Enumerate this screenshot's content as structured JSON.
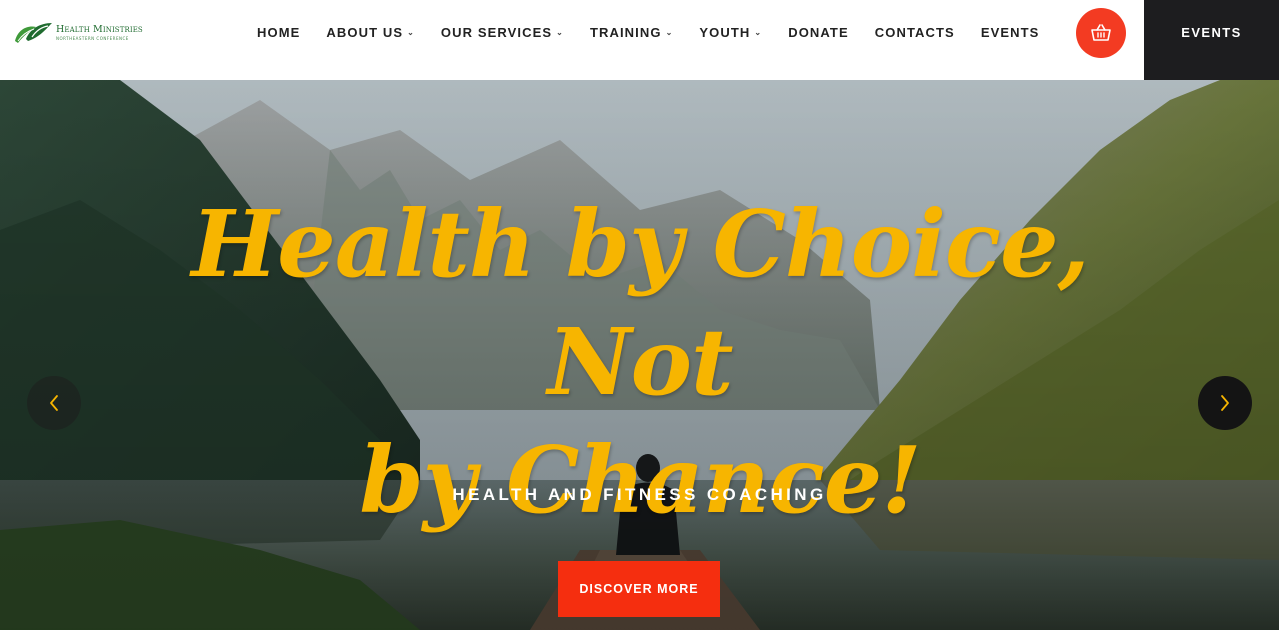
{
  "logo": {
    "title": "Health Ministries",
    "subtitle": "NORTHEASTERN CONFERENCE"
  },
  "nav": [
    {
      "label": "HOME",
      "dropdown": false
    },
    {
      "label": "ABOUT US",
      "dropdown": true
    },
    {
      "label": "OUR SERVICES",
      "dropdown": true
    },
    {
      "label": "TRAINING",
      "dropdown": true
    },
    {
      "label": "YOUTH",
      "dropdown": true
    },
    {
      "label": "DONATE",
      "dropdown": false
    },
    {
      "label": "CONTACTS",
      "dropdown": false
    },
    {
      "label": "EVENTS",
      "dropdown": false
    }
  ],
  "cart": {
    "icon": "basket-icon",
    "color": "#f33b22"
  },
  "events_button": {
    "label": "EVENTS"
  },
  "hero": {
    "headline_line1": "Health by Choice, Not",
    "headline_line2": "by Chance!",
    "subtitle": "HEALTH AND FITNESS COACHING",
    "cta_label": "DISCOVER MORE",
    "accent_color": "#f7b500",
    "cta_color": "#f52e0f"
  },
  "slider": {
    "prev_icon": "chevron-left-icon",
    "next_icon": "chevron-right-icon"
  }
}
